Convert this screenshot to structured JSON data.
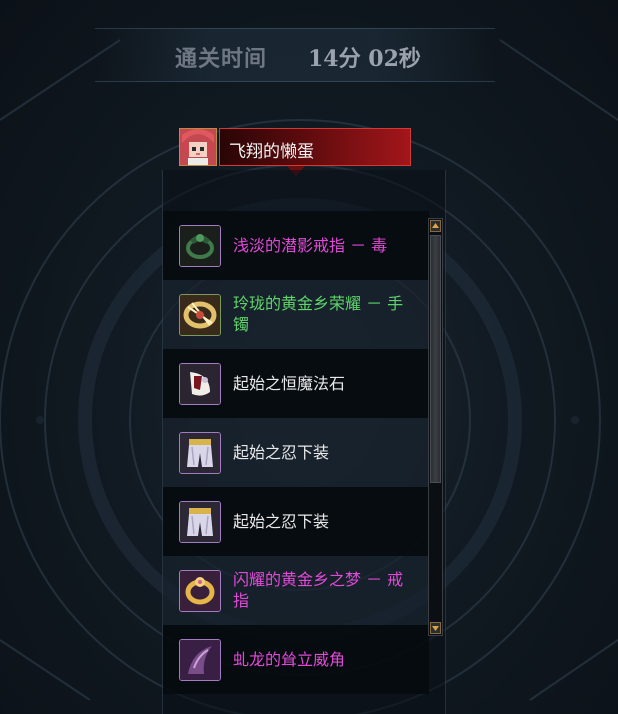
{
  "clear_time": {
    "label": "通关时间",
    "value": "14分 02秒"
  },
  "player": {
    "name": "飞翔的懒蛋",
    "avatar_icon": "red-haired-character-portrait-icon"
  },
  "loot": {
    "items": [
      {
        "name": "浅淡的潜影戒指 － 毒",
        "color": "#e04ad6",
        "icon": "shadow-ring-icon"
      },
      {
        "name": "玲珑的黄金乡荣耀 － 手镯",
        "color": "#5fd46a",
        "icon": "golden-bracelet-icon"
      },
      {
        "name": "起始之恒魔法石",
        "color": "#e9e9e9",
        "icon": "magic-stone-icon"
      },
      {
        "name": "起始之忍下装",
        "color": "#e9e9e9",
        "icon": "ninja-pants-icon"
      },
      {
        "name": "起始之忍下装",
        "color": "#e9e9e9",
        "icon": "ninja-pants-icon"
      },
      {
        "name": "闪耀的黄金乡之梦 － 戒指",
        "color": "#e04ad6",
        "icon": "golden-ring-icon"
      },
      {
        "name": "虬龙的耸立威角",
        "color": "#e04ad6",
        "icon": "dragon-horn-icon"
      }
    ]
  },
  "scrollbar": {
    "up_icon": "scroll-up-arrow-icon",
    "down_icon": "scroll-down-arrow-icon"
  },
  "colors": {
    "epic_item": "#e04ad6",
    "set_item": "#5fd46a",
    "common_item": "#e9e9e9",
    "name_plate": "#a3161a"
  }
}
